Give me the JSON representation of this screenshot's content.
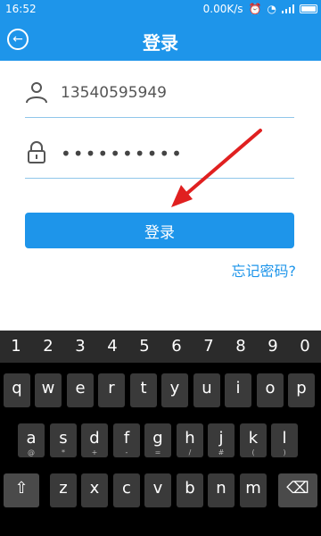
{
  "status": {
    "time": "16:52",
    "speed": "0.00K/s"
  },
  "header": {
    "title": "登录",
    "back_label": "←"
  },
  "form": {
    "phone_value": "13540595949",
    "password_mask": "••••••••••"
  },
  "actions": {
    "login_label": "登录",
    "forgot_label": "忘记密码?"
  },
  "keyboard": {
    "numbers": [
      "1",
      "2",
      "3",
      "4",
      "5",
      "6",
      "7",
      "8",
      "9",
      "0"
    ],
    "row1": [
      "q",
      "w",
      "e",
      "r",
      "t",
      "y",
      "u",
      "i",
      "o",
      "p"
    ],
    "row2": [
      "a",
      "s",
      "d",
      "f",
      "g",
      "h",
      "j",
      "k",
      "l"
    ],
    "row2_sub": [
      "@",
      "*",
      "+",
      "-",
      "=",
      "/",
      "#",
      "(",
      ")"
    ],
    "row3": [
      "z",
      "x",
      "c",
      "v",
      "b",
      "n",
      "m"
    ],
    "row3_sub": [
      "",
      "",
      "",
      "",
      "",
      "",
      ""
    ],
    "shift_label": "⇧",
    "backspace_label": "⌫"
  }
}
